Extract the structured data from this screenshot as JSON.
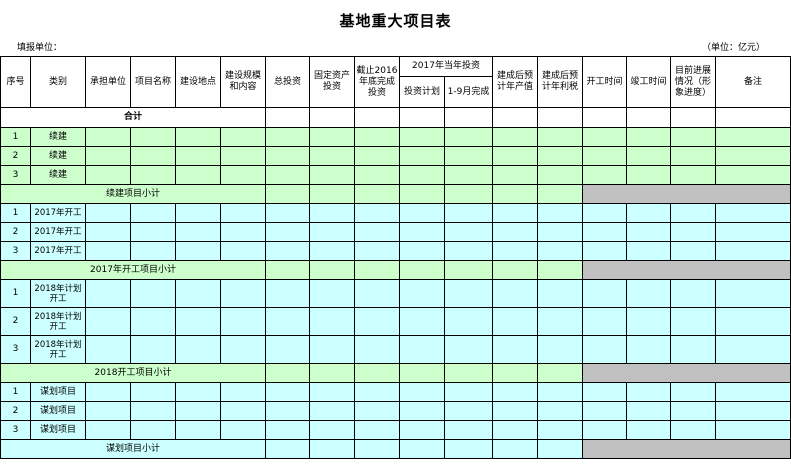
{
  "title": "基地重大项目表",
  "fill_unit_label": "填报单位：",
  "unit_note": "（单位：亿元）",
  "headers": {
    "seq": "序号",
    "category": "类别",
    "contractor": "承担单位",
    "project_name": "项目名称",
    "location": "建设地点",
    "scale": "建设规模和内容",
    "total_invest": "总投资",
    "fixed_assets": "固定资产投资",
    "cutoff_2016": "截止2016年底完成投资",
    "invest_2017": "2017年当年投资",
    "invest_plan": "投资计划",
    "done_1_9": "1-9月完成",
    "output_value": "建成后预计年产值",
    "profit_tax": "建成后预计年利税",
    "start_time": "开工时间",
    "finish_time": "竣工时间",
    "progress": "目前进展情况（形象进度）",
    "remarks": "备注"
  },
  "total_label": "合计",
  "sections": [
    {
      "rows": [
        {
          "seq": "1",
          "category": "续建"
        },
        {
          "seq": "2",
          "category": "续建"
        },
        {
          "seq": "3",
          "category": "续建"
        }
      ],
      "subtotal": "续建项目小计"
    },
    {
      "rows": [
        {
          "seq": "1",
          "category": "2017年开工"
        },
        {
          "seq": "2",
          "category": "2017年开工"
        },
        {
          "seq": "3",
          "category": "2017年开工"
        }
      ],
      "subtotal": "2017年开工项目小计"
    },
    {
      "rows": [
        {
          "seq": "1",
          "category": "2018年计划开工"
        },
        {
          "seq": "2",
          "category": "2018年计划开工"
        },
        {
          "seq": "3",
          "category": "2018年计划开工"
        }
      ],
      "subtotal": "2018开工项目小计"
    },
    {
      "rows": [
        {
          "seq": "1",
          "category": "谋划项目"
        },
        {
          "seq": "2",
          "category": "谋划项目"
        },
        {
          "seq": "3",
          "category": "谋划项目"
        }
      ],
      "subtotal": "谋划项目小计"
    }
  ],
  "colors": {
    "green": "#ccffcc",
    "cyan": "#ccffff",
    "gray": "#c0c0c0"
  }
}
